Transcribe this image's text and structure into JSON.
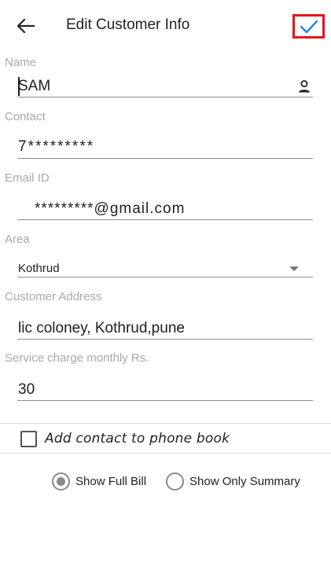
{
  "header": {
    "title": "Edit Customer Info",
    "back_icon": "arrow-left-icon",
    "save_icon": "check-icon",
    "save_color": "#1e88e5",
    "highlight_color": "#e8141c"
  },
  "fields": {
    "name": {
      "label": "Name",
      "value": "SAM"
    },
    "contact": {
      "label": "Contact",
      "value": "7*********"
    },
    "email": {
      "label": "Email ID",
      "value": "*********@gmail.com"
    },
    "area": {
      "label": "Area",
      "value": "Kothrud"
    },
    "address": {
      "label": "Customer Address",
      "value": "lic coloney, Kothrud,pune"
    },
    "service_charge": {
      "label": "Service charge monthly Rs.",
      "value": "30"
    }
  },
  "options": {
    "add_contact_label": "Add contact to phone book",
    "add_contact_checked": false,
    "show_full_bill_label": "Show Full Bill",
    "show_full_bill_selected": true,
    "show_only_summary_label": "Show Only Summary",
    "show_only_summary_selected": false
  }
}
